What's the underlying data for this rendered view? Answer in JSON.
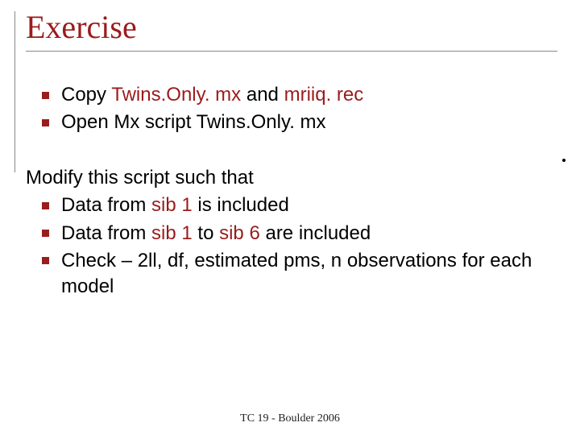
{
  "title": "Exercise",
  "list1": {
    "items": [
      {
        "pre": "Copy ",
        "a1": "Twins.Only. mx",
        "mid": " and ",
        "a2": "mriiq. rec",
        "post": ""
      },
      {
        "pre": "Open Mx script Twins.Only. mx",
        "a1": "",
        "mid": "",
        "a2": "",
        "post": ""
      }
    ]
  },
  "lead": "Modify this script such that",
  "list2": {
    "items": [
      {
        "pre": "Data from ",
        "a1": "sib 1",
        "mid": " is included",
        "a2": "",
        "post": ""
      },
      {
        "pre": "Data from ",
        "a1": "sib 1",
        "mid": " to ",
        "a2": "sib 6",
        "post": " are included"
      },
      {
        "pre": "Check – 2ll, df, estimated pms, n observations for each model",
        "a1": "",
        "mid": "",
        "a2": "",
        "post": ""
      }
    ]
  },
  "footer": "TC 19 - Boulder 2006"
}
